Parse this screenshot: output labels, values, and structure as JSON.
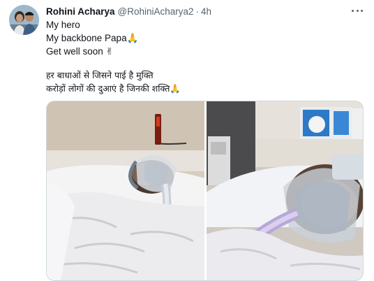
{
  "author": {
    "name": "Rohini Acharya",
    "handle": "@RohiniAcharya2",
    "separator": "·",
    "time": "4h"
  },
  "tweet": {
    "lines": [
      "My hero",
      "My backbone Papa🙏",
      "Get well soon ✌"
    ],
    "hindi_lines": [
      "हर बाधाओं से जिसने पाई है मुक्ति",
      "करोड़ों लोगों की दुआएं है जिनकी शक्ति🙏"
    ]
  },
  "icons": {
    "more": "more-horizontal-icon",
    "pray": "folded-hands-emoji",
    "victory": "victory-hand-emoji"
  },
  "colors": {
    "text": "#0f1419",
    "secondary": "#536471",
    "border": "#cfd9de"
  }
}
